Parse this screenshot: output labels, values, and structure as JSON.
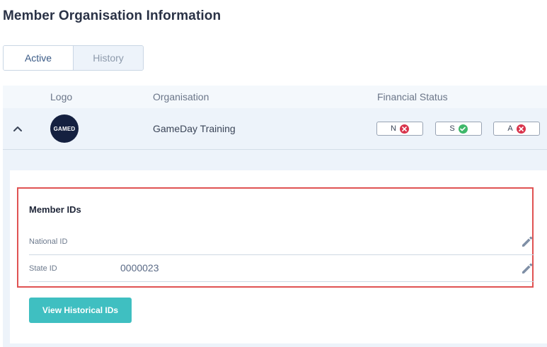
{
  "page": {
    "title": "Member Organisation Information"
  },
  "tabs": [
    {
      "label": "Active"
    },
    {
      "label": "History"
    }
  ],
  "table": {
    "headers": {
      "logo": "Logo",
      "organisation": "Organisation",
      "financial_status": "Financial Status"
    },
    "row": {
      "logo_text": "GAMED",
      "organisation": "GameDay Training",
      "statuses": [
        {
          "letter": "N",
          "state": "cross",
          "color": "#d9344c"
        },
        {
          "letter": "S",
          "state": "check",
          "color": "#3fb86a"
        },
        {
          "letter": "A",
          "state": "cross",
          "color": "#d9344c"
        }
      ]
    }
  },
  "member_ids": {
    "title": "Member IDs",
    "rows": [
      {
        "label": "National ID",
        "value": ""
      },
      {
        "label": "State ID",
        "value": "0000023"
      }
    ],
    "button_label": "View Historical IDs"
  },
  "colors": {
    "accent_button": "#3fbfc1",
    "highlight_border": "#e05252",
    "row_background": "#edf3fa"
  }
}
